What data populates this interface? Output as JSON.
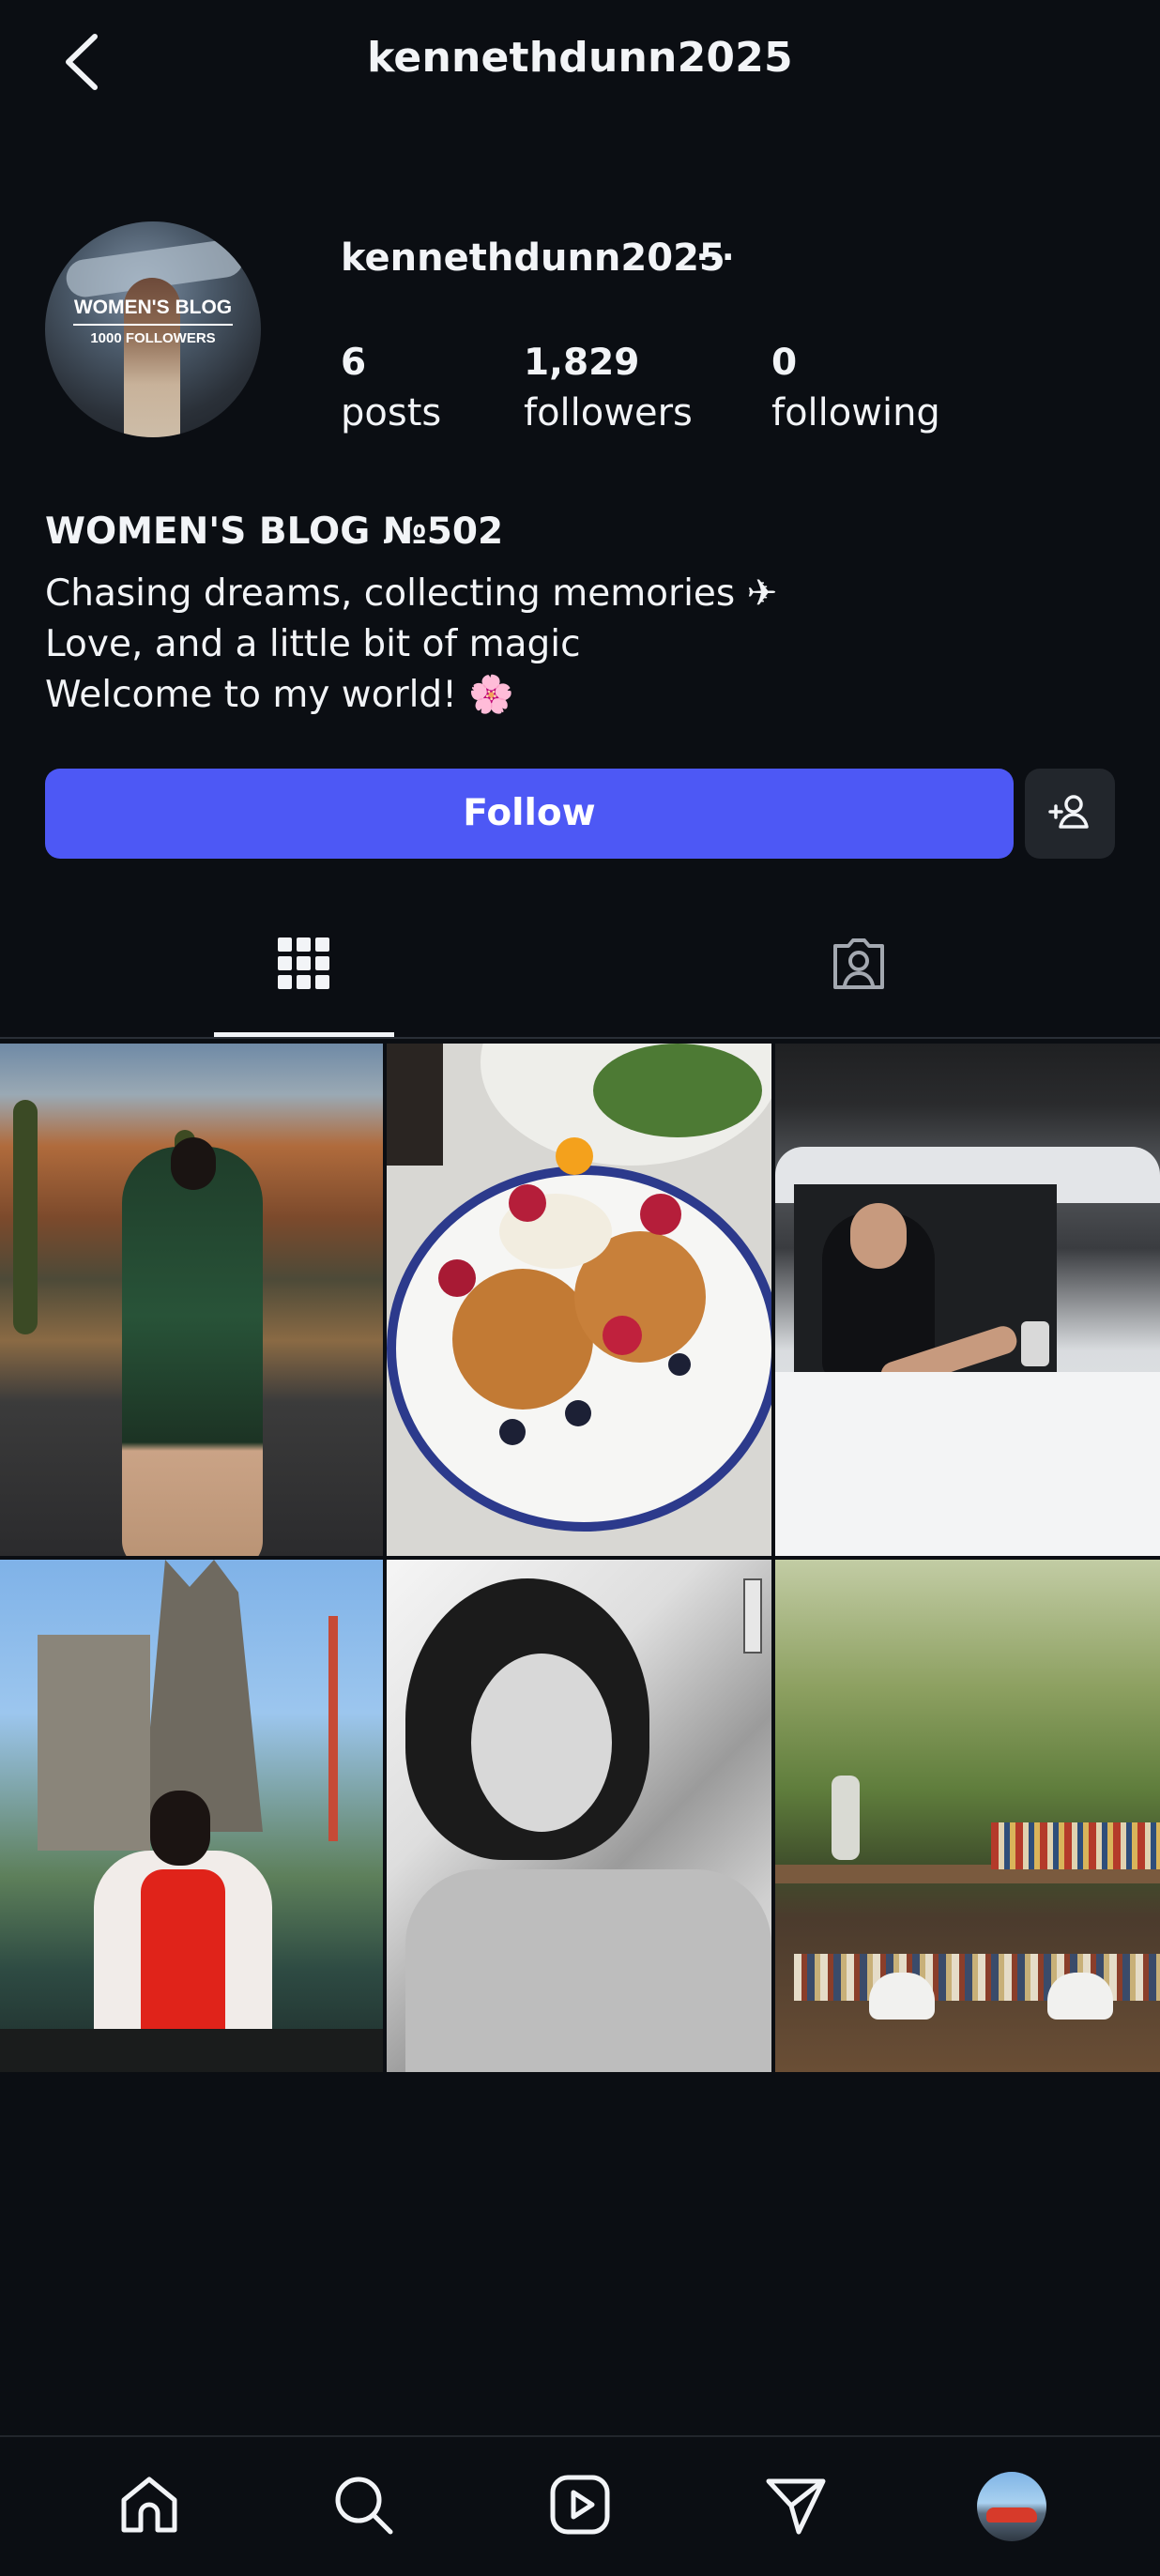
{
  "header": {
    "title": "kennethdunn2025",
    "back_icon": "chevron-left-icon"
  },
  "profile": {
    "username": "kennethdunn2025",
    "more_icon": "more-horizontal-icon",
    "more_label": "···",
    "avatar": {
      "line1": "WOMEN'S BLOG",
      "line2": "1000 FOLLOWERS"
    },
    "stats": [
      {
        "value": "6",
        "label": "posts"
      },
      {
        "value": "1,829",
        "label": "followers"
      },
      {
        "value": "0",
        "label": "following"
      }
    ],
    "bio": {
      "name": "WOMEN'S BLOG №502",
      "lines": [
        "Chasing dreams, collecting memories ✈",
        "Love, and a little bit of magic",
        "Welcome to my world! 🌸"
      ]
    }
  },
  "actions": {
    "follow_label": "Follow",
    "follow_color": "#4d58f5",
    "suggest_icon": "add-person-icon"
  },
  "tabs": [
    {
      "icon": "grid-icon",
      "active": true
    },
    {
      "icon": "tagged-person-icon",
      "active": false
    }
  ],
  "posts": [
    {
      "subject": "woman in green dress, desert mountains"
    },
    {
      "subject": "pancakes with berries on plate"
    },
    {
      "subject": "woman in white car taking selfie"
    },
    {
      "subject": "woman in red dress near cathedral"
    },
    {
      "subject": "black and white portrait"
    },
    {
      "subject": "bookshelf room with trees"
    }
  ],
  "bottom_nav": [
    {
      "icon": "home-icon"
    },
    {
      "icon": "search-icon"
    },
    {
      "icon": "reels-icon"
    },
    {
      "icon": "send-icon"
    },
    {
      "icon": "profile-avatar"
    }
  ],
  "colors": {
    "background": "#0b0e13",
    "text": "#f2f4f7",
    "secondary_button": "#22262c"
  }
}
